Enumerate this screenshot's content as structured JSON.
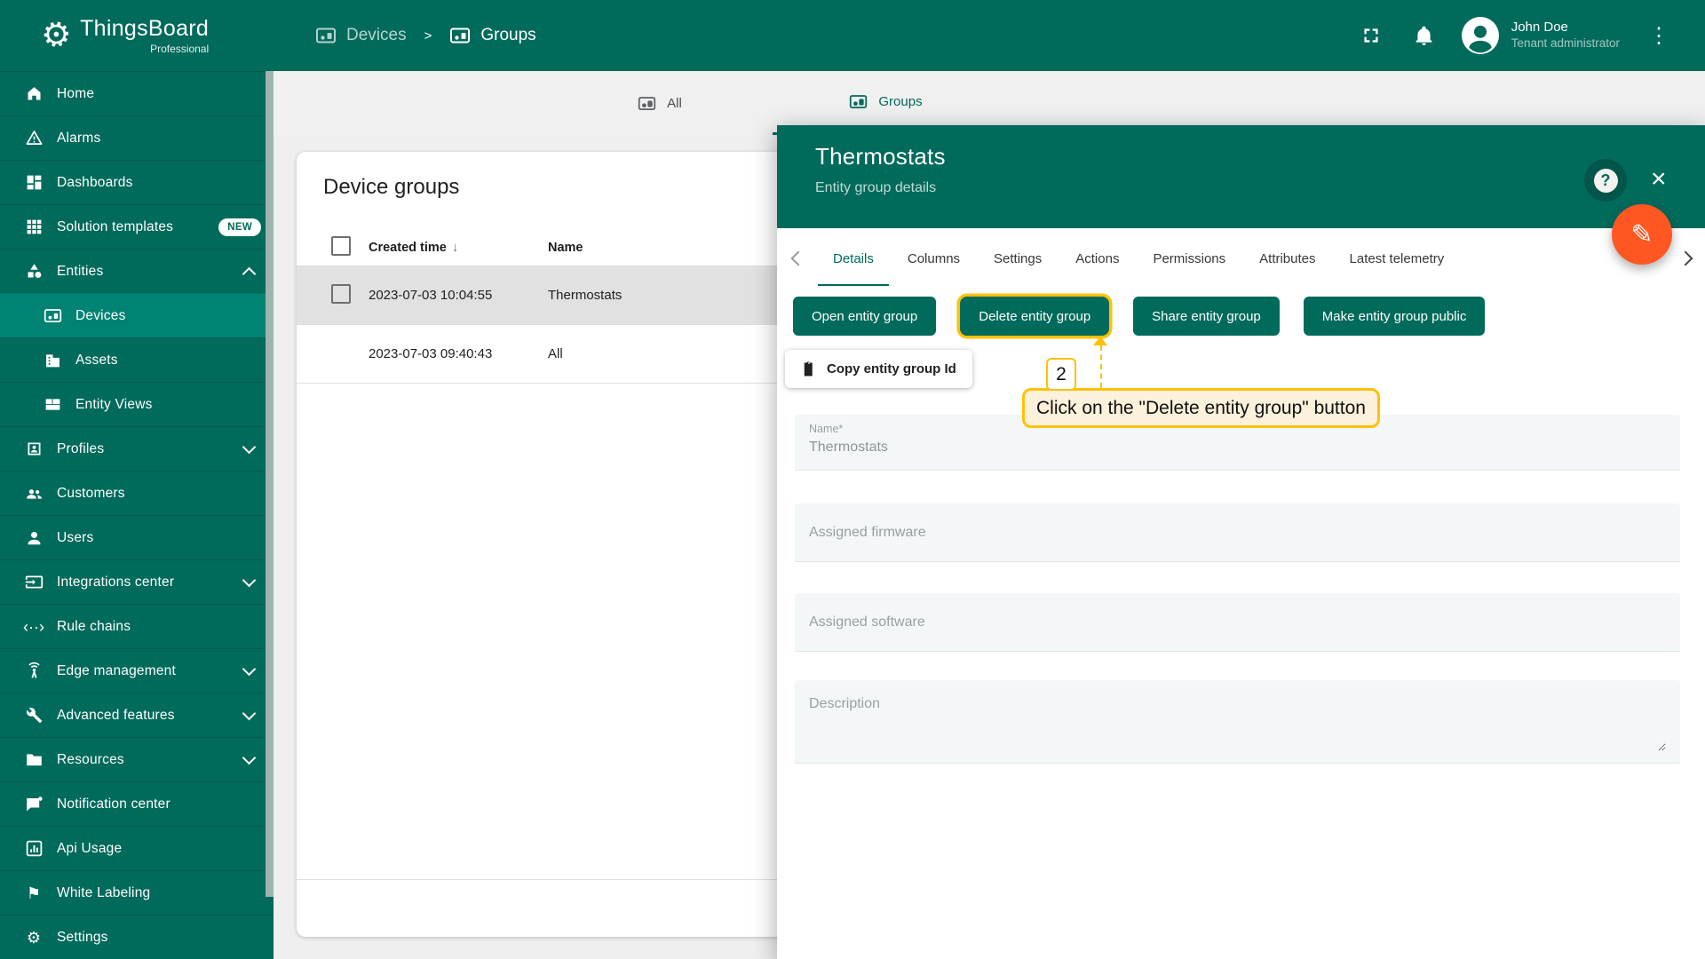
{
  "app": {
    "brand": "ThingsBoard",
    "brand_suffix": "Professional"
  },
  "colors": {
    "primary": "#006A5B",
    "primary_light": "#008372",
    "fab_orange": "#FF5722",
    "highlight_gold": "#FFC107",
    "tooltip_bg": "#FCF1DB",
    "row_selected": "#E1E1E1",
    "content_bg": "#EFEFEF",
    "field_bg": "#F4F7F8"
  },
  "glyphs": {
    "logo": "⚙",
    "rule_chains": "‹··›",
    "white_labeling": "⚑",
    "settings": "⚙",
    "more": "⋮",
    "close": "×",
    "help": "?",
    "edit": "✎",
    "sort_desc": "↓",
    "breadcrumb_sep": ">"
  },
  "topbar": {
    "breadcrumb": [
      {
        "label": "Devices"
      },
      {
        "label": "Groups"
      }
    ],
    "user": {
      "name": "John Doe",
      "role": "Tenant administrator"
    }
  },
  "sidebar": {
    "items": [
      {
        "label": "Home"
      },
      {
        "label": "Alarms"
      },
      {
        "label": "Dashboards"
      },
      {
        "label": "Solution templates",
        "badge": "NEW"
      },
      {
        "label": "Entities"
      },
      {
        "label": "Devices"
      },
      {
        "label": "Assets"
      },
      {
        "label": "Entity Views"
      },
      {
        "label": "Profiles"
      },
      {
        "label": "Customers"
      },
      {
        "label": "Users"
      },
      {
        "label": "Integrations center"
      },
      {
        "label": "Rule chains"
      },
      {
        "label": "Edge management"
      },
      {
        "label": "Advanced features"
      },
      {
        "label": "Resources"
      },
      {
        "label": "Notification center"
      },
      {
        "label": "Api Usage"
      },
      {
        "label": "White Labeling"
      },
      {
        "label": "Settings"
      }
    ]
  },
  "content": {
    "tabs": [
      {
        "label": "All"
      },
      {
        "label": "Groups"
      }
    ],
    "card": {
      "title": "Device groups",
      "columns": {
        "created": "Created time",
        "name": "Name"
      },
      "rows": [
        {
          "created": "2023-07-03 10:04:55",
          "name": "Thermostats"
        },
        {
          "created": "2023-07-03 09:40:43",
          "name": "All"
        }
      ]
    }
  },
  "panel": {
    "title": "Thermostats",
    "subtitle": "Entity group details",
    "tabs": [
      {
        "label": "Details"
      },
      {
        "label": "Columns"
      },
      {
        "label": "Settings"
      },
      {
        "label": "Actions"
      },
      {
        "label": "Permissions"
      },
      {
        "label": "Attributes"
      },
      {
        "label": "Latest telemetry"
      }
    ],
    "buttons": [
      {
        "label": "Open entity group"
      },
      {
        "label": "Delete entity group"
      },
      {
        "label": "Share entity group"
      },
      {
        "label": "Make entity group public"
      }
    ],
    "copy_button": "Copy entity group Id",
    "form": {
      "name_label": "Name*",
      "name_value": "Thermostats",
      "firmware_placeholder": "Assigned firmware",
      "software_placeholder": "Assigned software",
      "description_placeholder": "Description"
    }
  },
  "tutorial": {
    "step": "2",
    "text": "Click on the \"Delete entity group\" button"
  }
}
